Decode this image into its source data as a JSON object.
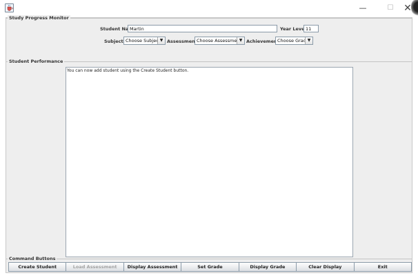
{
  "window": {
    "minimize_glyph": "—",
    "maximize_glyph": "☐",
    "close_glyph": "✕",
    "app_icon": "java-cup-icon"
  },
  "monitor": {
    "title": "Study Progress Monitor",
    "student_name_label": "Student Name",
    "student_name_value": "Martin",
    "year_level_label": "Year Level",
    "year_level_value": "11",
    "subjects_label": "Subjects",
    "subjects_selected": "Choose Subject",
    "assessments_label": "Assessments",
    "assessments_selected": "Choose Assessment",
    "achievements_label": "Achievements",
    "achievements_selected": "Choose Grade"
  },
  "performance": {
    "title": "Student Performance",
    "output_text": "You can now add student using the  Create Student button."
  },
  "commands": {
    "title": "Command Buttons",
    "create_student": "Create Student",
    "load_assessment": "Load Assessment",
    "display_assessment": "Display Assessment",
    "set_grade": "Set Grade",
    "display_grade": "Display Grade",
    "clear_display": "Clear Display",
    "exit": "Exit"
  },
  "icons": {
    "combo_arrow": "▼"
  },
  "colors": {
    "panel_bg": "#eeeeee",
    "disabled_text": "#a4a4a4"
  }
}
